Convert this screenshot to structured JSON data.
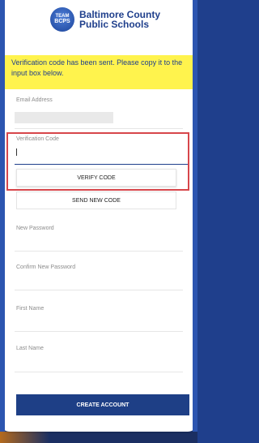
{
  "brand": {
    "badge_line1": "TEAM",
    "badge_line2": "BCPS",
    "name_line1": "Baltimore County",
    "name_line2": "Public Schools"
  },
  "banner": {
    "message": "Verification code has been sent. Please copy it to the input box below."
  },
  "form": {
    "email_label": "Email Address",
    "email_value": "",
    "verification_label": "Verification Code",
    "verification_value": "",
    "verify_button": "VERIFY CODE",
    "send_new_button": "SEND NEW CODE",
    "new_password_label": "New Password",
    "confirm_password_label": "Confirm New Password",
    "first_name_label": "First Name",
    "last_name_label": "Last Name",
    "create_button": "CREATE ACCOUNT"
  },
  "colors": {
    "brand_blue": "#1f3f8c",
    "banner_yellow": "#fff34d",
    "focus_red": "#d7464b"
  }
}
